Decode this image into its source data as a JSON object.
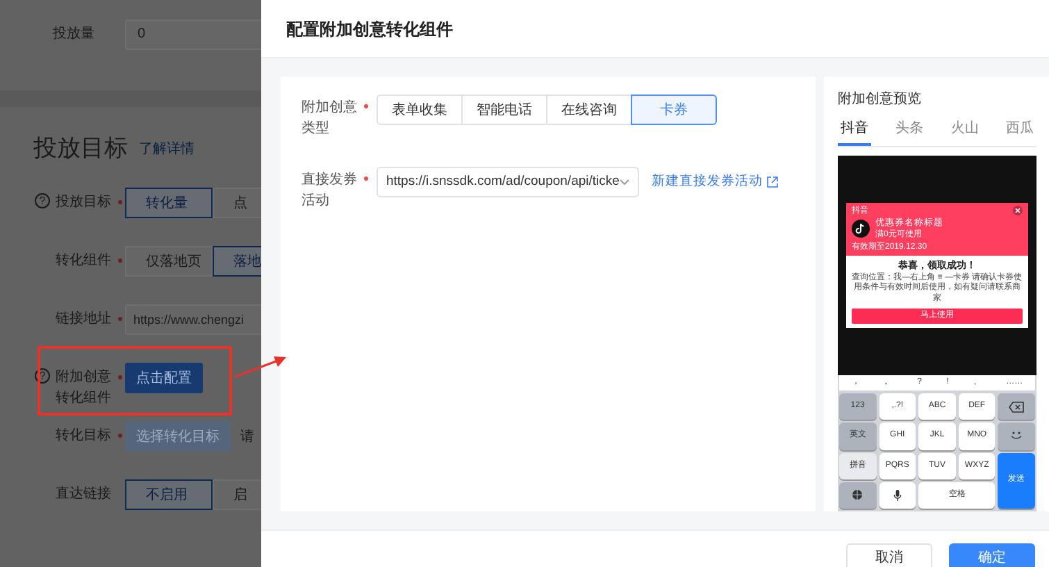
{
  "background_page": {
    "quantity": {
      "label": "投放量",
      "value": "0"
    },
    "section_title": "投放目标",
    "section_link": "了解详情",
    "rows": [
      {
        "kind": "segments",
        "label": "投放目标",
        "help_icon": "?",
        "required": true,
        "options": [
          {
            "label": "转化量",
            "selected": true
          },
          {
            "label": "点",
            "selected": false
          }
        ]
      },
      {
        "kind": "segments",
        "label": "转化组件",
        "required": true,
        "options": [
          {
            "label": "仅落地页",
            "selected": false
          },
          {
            "label": "落地",
            "selected": true
          }
        ]
      },
      {
        "kind": "input",
        "label": "链接地址",
        "required": true,
        "value": "https://www.chengzi"
      },
      {
        "kind": "button",
        "label": "附加创意转化组件",
        "help_icon": "?",
        "required": true,
        "highlighted": true,
        "button": "点击配置",
        "disabled": false
      },
      {
        "kind": "button",
        "label": "转化目标",
        "required": true,
        "highlighted": false,
        "button": "选择转化目标",
        "disabled": true,
        "hint": "请"
      },
      {
        "kind": "segments",
        "label": "直达链接",
        "required": false,
        "options": [
          {
            "label": "不启用",
            "selected": true
          },
          {
            "label": "启",
            "selected": false
          }
        ]
      }
    ]
  },
  "drawer": {
    "title": "配置附加创意转化组件",
    "form": [
      {
        "kind": "segments",
        "label": "附加创意类型",
        "required": true,
        "options": [
          {
            "label": "表单收集",
            "selected": false
          },
          {
            "label": "智能电话",
            "selected": false
          },
          {
            "label": "在线咨询",
            "selected": false
          },
          {
            "label": "卡券",
            "selected": true
          }
        ]
      },
      {
        "kind": "select",
        "label": "直接发券活动",
        "required": true,
        "value": "https://i.snssdk.com/ad/coupon/api/ticke",
        "link": "新建直接发券活动"
      }
    ],
    "preview": {
      "title": "附加创意预览",
      "tabs": [
        {
          "label": "抖音",
          "selected": true
        },
        {
          "label": "头条",
          "selected": false
        },
        {
          "label": "火山",
          "selected": false
        },
        {
          "label": "西瓜",
          "selected": false
        }
      ],
      "coupon": {
        "app": "抖音",
        "name": "优惠券名称标题",
        "condition": "满0元可使用",
        "validity": "有效期至2019.12.30",
        "success": "恭喜，领取成功！",
        "instructions": "查询位置：我—右上角 ≡ —卡券 请确认卡券使用条件与有效时间后使用，如有疑问请联系商家",
        "button": "马上使用"
      },
      "keyboard": {
        "punctuation": [
          "，",
          "。",
          "?",
          "!",
          "、",
          "……"
        ],
        "keys": [
          {
            "kind": "func",
            "label": "123"
          },
          {
            "kind": "char",
            "label": ",.?!"
          },
          {
            "kind": "char",
            "label": "ABC"
          },
          {
            "kind": "char",
            "label": "DEF"
          },
          {
            "kind": "backspace"
          },
          {
            "kind": "func",
            "label": "英文"
          },
          {
            "kind": "char",
            "label": "GHI"
          },
          {
            "kind": "char",
            "label": "JKL"
          },
          {
            "kind": "char",
            "label": "MNO"
          },
          {
            "kind": "emoji"
          },
          {
            "kind": "active",
            "label": "拼音"
          },
          {
            "kind": "char",
            "label": "PQRS"
          },
          {
            "kind": "char",
            "label": "TUV"
          },
          {
            "kind": "char",
            "label": "WXYZ"
          },
          {
            "kind": "send",
            "label": "发送"
          },
          {
            "kind": "globe"
          },
          {
            "kind": "mic"
          },
          {
            "kind": "space",
            "label": "空格"
          }
        ]
      }
    },
    "buttons": [
      {
        "label": "取消",
        "kind": "secondary"
      },
      {
        "label": "确定",
        "kind": "primary"
      }
    ]
  }
}
